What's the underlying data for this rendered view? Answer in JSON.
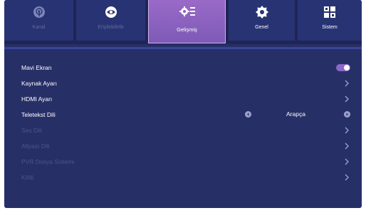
{
  "tabs": [
    {
      "label": "Kanal",
      "icon": "broadcast-icon"
    },
    {
      "label": "Erişilebilirlik",
      "icon": "eye-icon"
    },
    {
      "label": "Gelişmiş",
      "icon": "advanced-settings-icon"
    },
    {
      "label": "Genel",
      "icon": "gear-icon"
    },
    {
      "label": "Sistem",
      "icon": "grid-icon"
    }
  ],
  "menu": {
    "items": [
      {
        "label": "Mavi Ekran"
      },
      {
        "label": "Kaynak Ayarı"
      },
      {
        "label": "HDMI Ayarı"
      },
      {
        "label": "Teletekst Dili",
        "value": "Arapça"
      },
      {
        "label": "Ses Dili"
      },
      {
        "label": "Altyazı Dili"
      },
      {
        "label": "PVR Dosya Sistemi"
      },
      {
        "label": "Kilitli"
      }
    ],
    "blue_screen_on": true
  },
  "colors": {
    "background": "#272f67",
    "tab_active": "#8a62c0",
    "toggle_on": "#8a68c6"
  }
}
